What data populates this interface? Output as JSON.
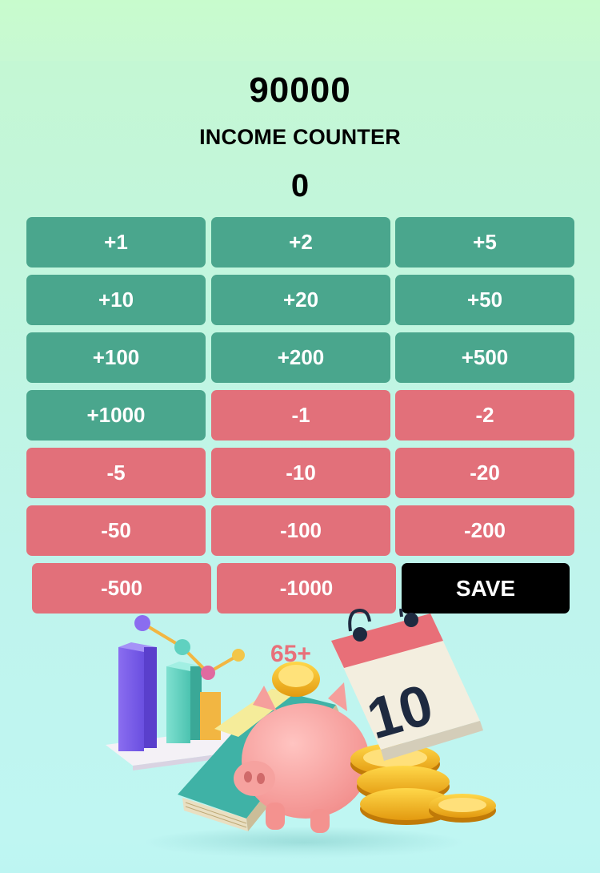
{
  "counter": {
    "total": "90000",
    "title": "INCOME COUNTER",
    "current": "0"
  },
  "buttons": {
    "plus_1": "+1",
    "plus_2": "+2",
    "plus_5": "+5",
    "plus_10": "+10",
    "plus_20": "+20",
    "plus_50": "+50",
    "plus_100": "+100",
    "plus_200": "+200",
    "plus_500": "+500",
    "plus_1000": "+1000",
    "minus_1": "-1",
    "minus_2": "-2",
    "minus_5": "-5",
    "minus_10": "-10",
    "minus_20": "-20",
    "minus_50": "-50",
    "minus_100": "-100",
    "minus_200": "-200",
    "minus_500": "-500",
    "minus_1000": "-1000",
    "save": "SAVE"
  },
  "illustration": {
    "calendar_day": "10",
    "tag_text": "65+",
    "icons": [
      "bar-chart-icon",
      "book-icon",
      "piggy-bank-icon",
      "calendar-icon",
      "coins-icon"
    ]
  },
  "colors": {
    "plus": "#4aa68d",
    "minus": "#e2707a",
    "save": "#000000"
  }
}
